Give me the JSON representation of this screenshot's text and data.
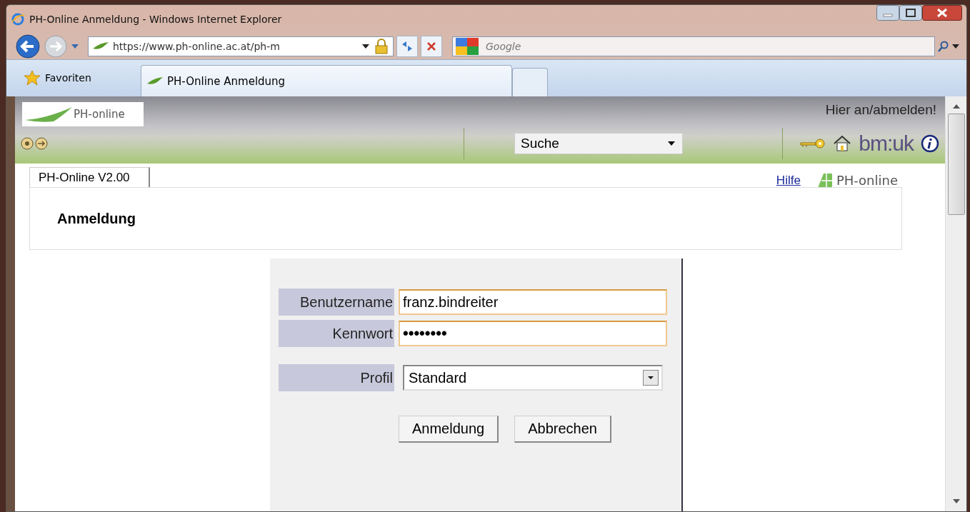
{
  "window": {
    "title": "PH-Online Anmeldung - Windows Internet Explorer"
  },
  "address_bar": {
    "url": "https://www.ph-online.ac.at/ph-m"
  },
  "search_box": {
    "placeholder": "Google"
  },
  "favorites": {
    "label": "Favoriten"
  },
  "tabs": [
    {
      "label": "PH-Online Anmeldung",
      "selected": true
    }
  ],
  "page": {
    "logo": "PH-online",
    "login_link": "Hier an/abmelden!",
    "search_select": "Suche",
    "brand": "bm:uk",
    "page_tab": "PH-Online V2.00",
    "help_link": "Hilfe",
    "small_logo": "PH-online",
    "heading": "Anmeldung",
    "form": {
      "fields": [
        {
          "label": "Benutzername",
          "value": "franz.bindreiter",
          "kind": "text"
        },
        {
          "label": "Kennwort",
          "value": "••••••••",
          "kind": "password"
        },
        {
          "label": "Profil",
          "value": "Standard",
          "kind": "select"
        }
      ],
      "buttons": [
        "Anmeldung",
        "Abbrechen"
      ]
    }
  }
}
